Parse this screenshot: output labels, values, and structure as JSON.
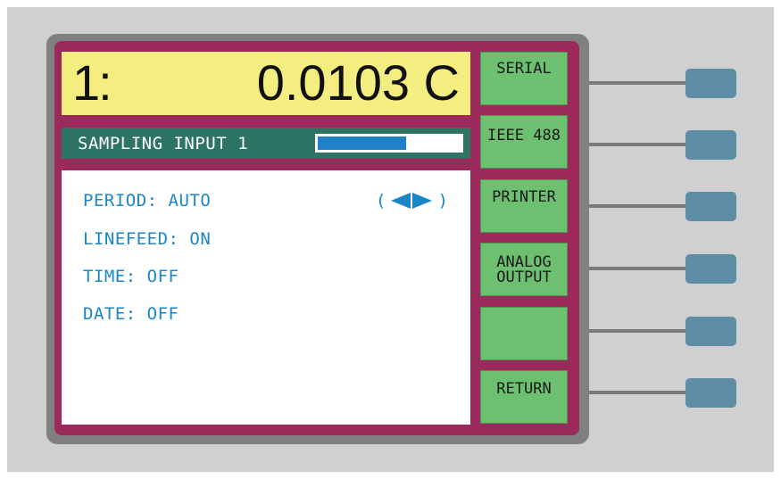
{
  "readout": {
    "channel": "1:",
    "value": "0.0103 C"
  },
  "status": {
    "label": "SAMPLING INPUT 1",
    "progress_fraction": 0.62,
    "progress_color": "#1f82c8"
  },
  "params": {
    "period": "PERIOD: AUTO",
    "linefeed": "LINEFEED: ON",
    "time": "TIME: OFF",
    "date": "DATE: OFF",
    "adjust_open": "(",
    "adjust_close": ")",
    "adjust_icons": [
      "left-triangle-icon",
      "right-triangle-icon"
    ]
  },
  "softkeys": [
    {
      "label": "SERIAL"
    },
    {
      "label": "IEEE 488"
    },
    {
      "label": "PRINTER"
    },
    {
      "label": "ANALOG\nOUTPUT"
    },
    {
      "label": ""
    },
    {
      "label": "RETURN"
    }
  ],
  "colors": {
    "screen_frame": "#9a2a5c",
    "readout_bg": "#f4ee80",
    "status_bg": "#2e7464",
    "param_text": "#1a86c6",
    "softkey_bg": "#6cc070",
    "hardware_button": "#5e8da6"
  }
}
